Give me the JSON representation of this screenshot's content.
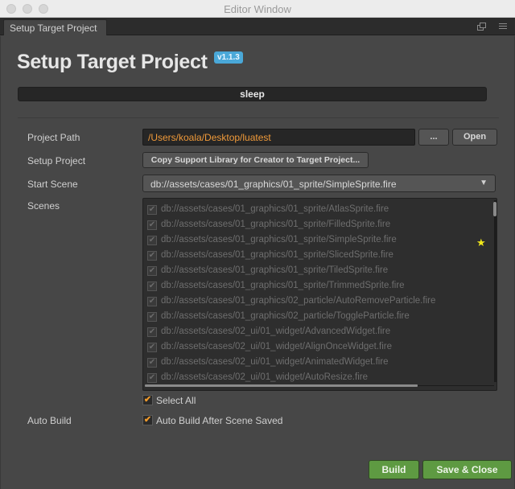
{
  "window": {
    "title": "Editor Window"
  },
  "tabbar": {
    "tab_label": "Setup Target Project",
    "icons": [
      "popout-icon",
      "menu-icon"
    ]
  },
  "header": {
    "title": "Setup Target Project",
    "version": "v1.1.3"
  },
  "status": {
    "text": "sleep"
  },
  "form": {
    "project_path": {
      "label": "Project Path",
      "value": "/Users/koala/Desktop/luatest",
      "browse_label": "...",
      "open_label": "Open"
    },
    "setup_project": {
      "label": "Setup Project",
      "button_label": "Copy Support Library for Creator to Target Project..."
    },
    "start_scene": {
      "label": "Start Scene",
      "selected": "db://assets/cases/01_graphics/01_sprite/SimpleSprite.fire"
    },
    "scenes": {
      "label": "Scenes",
      "items": [
        {
          "path": "db://assets/cases/01_graphics/01_sprite/AtlasSprite.fire",
          "checked": true,
          "start": false
        },
        {
          "path": "db://assets/cases/01_graphics/01_sprite/FilledSprite.fire",
          "checked": true,
          "start": false
        },
        {
          "path": "db://assets/cases/01_graphics/01_sprite/SimpleSprite.fire",
          "checked": true,
          "start": true
        },
        {
          "path": "db://assets/cases/01_graphics/01_sprite/SlicedSprite.fire",
          "checked": true,
          "start": false
        },
        {
          "path": "db://assets/cases/01_graphics/01_sprite/TiledSprite.fire",
          "checked": true,
          "start": false
        },
        {
          "path": "db://assets/cases/01_graphics/01_sprite/TrimmedSprite.fire",
          "checked": true,
          "start": false
        },
        {
          "path": "db://assets/cases/01_graphics/02_particle/AutoRemoveParticle.fire",
          "checked": true,
          "start": false
        },
        {
          "path": "db://assets/cases/01_graphics/02_particle/ToggleParticle.fire",
          "checked": true,
          "start": false
        },
        {
          "path": "db://assets/cases/02_ui/01_widget/AdvancedWidget.fire",
          "checked": true,
          "start": false
        },
        {
          "path": "db://assets/cases/02_ui/01_widget/AlignOnceWidget.fire",
          "checked": true,
          "start": false
        },
        {
          "path": "db://assets/cases/02_ui/01_widget/AnimatedWidget.fire",
          "checked": true,
          "start": false
        },
        {
          "path": "db://assets/cases/02_ui/01_widget/AutoResize.fire",
          "checked": true,
          "start": false
        }
      ],
      "select_all_label": "Select All",
      "select_all_checked": true
    },
    "auto_build": {
      "label": "Auto Build",
      "checkbox_label": "Auto Build After Scene Saved",
      "checked": true
    }
  },
  "footer": {
    "build_label": "Build",
    "save_close_label": "Save & Close"
  },
  "colors": {
    "path_text": "#f09a3a",
    "version_badge": "#4aa8d8",
    "primary_button": "#5e9a42",
    "checkbox_check": "#f19a2a",
    "start_star": "#f2e81a"
  }
}
